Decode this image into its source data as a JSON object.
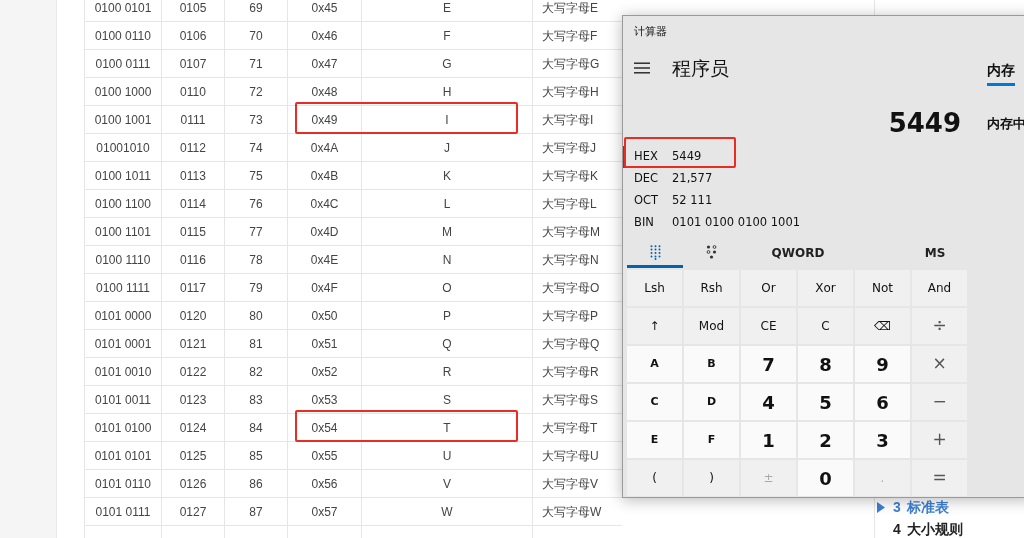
{
  "table": {
    "rows": [
      {
        "binary": "0100 0101",
        "octal": "0105",
        "decimal": "69",
        "hex": "0x45",
        "char": "E",
        "description": "大写字母E",
        "highlighted": false
      },
      {
        "binary": "0100 0110",
        "octal": "0106",
        "decimal": "70",
        "hex": "0x46",
        "char": "F",
        "description": "大写字母F",
        "highlighted": false
      },
      {
        "binary": "0100 0111",
        "octal": "0107",
        "decimal": "71",
        "hex": "0x47",
        "char": "G",
        "description": "大写字母G",
        "highlighted": false
      },
      {
        "binary": "0100 1000",
        "octal": "0110",
        "decimal": "72",
        "hex": "0x48",
        "char": "H",
        "description": "大写字母H",
        "highlighted": false
      },
      {
        "binary": "0100 1001",
        "octal": "0111",
        "decimal": "73",
        "hex": "0x49",
        "char": "I",
        "description": "大写字母I",
        "highlighted": true
      },
      {
        "binary": "01001010",
        "octal": "0112",
        "decimal": "74",
        "hex": "0x4A",
        "char": "J",
        "description": "大写字母J",
        "highlighted": false
      },
      {
        "binary": "0100 1011",
        "octal": "0113",
        "decimal": "75",
        "hex": "0x4B",
        "char": "K",
        "description": "大写字母K",
        "highlighted": false
      },
      {
        "binary": "0100 1100",
        "octal": "0114",
        "decimal": "76",
        "hex": "0x4C",
        "char": "L",
        "description": "大写字母L",
        "highlighted": false
      },
      {
        "binary": "0100 1101",
        "octal": "0115",
        "decimal": "77",
        "hex": "0x4D",
        "char": "M",
        "description": "大写字母M",
        "highlighted": false
      },
      {
        "binary": "0100 1110",
        "octal": "0116",
        "decimal": "78",
        "hex": "0x4E",
        "char": "N",
        "description": "大写字母N",
        "highlighted": false
      },
      {
        "binary": "0100 1111",
        "octal": "0117",
        "decimal": "79",
        "hex": "0x4F",
        "char": "O",
        "description": "大写字母O",
        "highlighted": false
      },
      {
        "binary": "0101 0000",
        "octal": "0120",
        "decimal": "80",
        "hex": "0x50",
        "char": "P",
        "description": "大写字母P",
        "highlighted": false
      },
      {
        "binary": "0101 0001",
        "octal": "0121",
        "decimal": "81",
        "hex": "0x51",
        "char": "Q",
        "description": "大写字母Q",
        "highlighted": false
      },
      {
        "binary": "0101 0010",
        "octal": "0122",
        "decimal": "82",
        "hex": "0x52",
        "char": "R",
        "description": "大写字母R",
        "highlighted": false
      },
      {
        "binary": "0101 0011",
        "octal": "0123",
        "decimal": "83",
        "hex": "0x53",
        "char": "S",
        "description": "大写字母S",
        "highlighted": false
      },
      {
        "binary": "0101 0100",
        "octal": "0124",
        "decimal": "84",
        "hex": "0x54",
        "char": "T",
        "description": "大写字母T",
        "highlighted": true
      },
      {
        "binary": "0101 0101",
        "octal": "0125",
        "decimal": "85",
        "hex": "0x55",
        "char": "U",
        "description": "大写字母U",
        "highlighted": false
      },
      {
        "binary": "0101 0110",
        "octal": "0126",
        "decimal": "86",
        "hex": "0x56",
        "char": "V",
        "description": "大写字母V",
        "highlighted": false
      },
      {
        "binary": "0101 0111",
        "octal": "0127",
        "decimal": "87",
        "hex": "0x57",
        "char": "W",
        "description": "大写字母W",
        "highlighted": false
      }
    ]
  },
  "calculator": {
    "window_title": "计算器",
    "mode_title": "程序员",
    "memory_tab": {
      "label": "内存",
      "selected": true
    },
    "display": "5449",
    "memory_text": "内存中",
    "radix": [
      {
        "label": "HEX",
        "value": "5449",
        "selected": true,
        "highlighted": true
      },
      {
        "label": "DEC",
        "value": "21,577",
        "selected": false,
        "highlighted": false
      },
      {
        "label": "OCT",
        "value": "52 111",
        "selected": false,
        "highlighted": false
      },
      {
        "label": "BIN",
        "value": "0101 0100 0100 1001",
        "selected": false,
        "highlighted": false
      }
    ],
    "keypad_modes": [
      {
        "kind": "full-keypad",
        "selected": true
      },
      {
        "kind": "bit-toggling",
        "selected": false
      }
    ],
    "word_size": "QWORD",
    "memory_store": "MS",
    "keys": [
      {
        "label": "Lsh",
        "kind": "function",
        "disabled": false
      },
      {
        "label": "Rsh",
        "kind": "function",
        "disabled": false
      },
      {
        "label": "Or",
        "kind": "function",
        "disabled": false
      },
      {
        "label": "Xor",
        "kind": "function",
        "disabled": false
      },
      {
        "label": "Not",
        "kind": "function",
        "disabled": false
      },
      {
        "label": "And",
        "kind": "function",
        "disabled": false
      },
      {
        "label": "↑",
        "kind": "function",
        "disabled": false
      },
      {
        "label": "Mod",
        "kind": "function",
        "disabled": false
      },
      {
        "label": "CE",
        "kind": "function",
        "disabled": false
      },
      {
        "label": "C",
        "kind": "function",
        "disabled": false
      },
      {
        "label": "⌫",
        "kind": "function",
        "disabled": false
      },
      {
        "label": "÷",
        "kind": "operator",
        "disabled": false
      },
      {
        "label": "A",
        "kind": "hex",
        "disabled": false
      },
      {
        "label": "B",
        "kind": "hex",
        "disabled": false
      },
      {
        "label": "7",
        "kind": "digit",
        "disabled": false
      },
      {
        "label": "8",
        "kind": "digit",
        "disabled": false
      },
      {
        "label": "9",
        "kind": "digit",
        "disabled": false
      },
      {
        "label": "×",
        "kind": "operator",
        "disabled": false
      },
      {
        "label": "C",
        "kind": "hex",
        "disabled": false
      },
      {
        "label": "D",
        "kind": "hex",
        "disabled": false
      },
      {
        "label": "4",
        "kind": "digit",
        "disabled": false
      },
      {
        "label": "5",
        "kind": "digit",
        "disabled": false
      },
      {
        "label": "6",
        "kind": "digit",
        "disabled": false
      },
      {
        "label": "−",
        "kind": "operator",
        "disabled": false
      },
      {
        "label": "E",
        "kind": "hex",
        "disabled": false
      },
      {
        "label": "F",
        "kind": "hex",
        "disabled": false
      },
      {
        "label": "1",
        "kind": "digit",
        "disabled": false
      },
      {
        "label": "2",
        "kind": "digit",
        "disabled": false
      },
      {
        "label": "3",
        "kind": "digit",
        "disabled": false
      },
      {
        "label": "+",
        "kind": "operator",
        "disabled": false
      },
      {
        "label": "(",
        "kind": "function",
        "disabled": false
      },
      {
        "label": ")",
        "kind": "function",
        "disabled": false
      },
      {
        "label": "±",
        "kind": "function",
        "disabled": true
      },
      {
        "label": "0",
        "kind": "digit",
        "disabled": false
      },
      {
        "label": ".",
        "kind": "digit",
        "disabled": true
      },
      {
        "label": "=",
        "kind": "operator",
        "disabled": false
      }
    ]
  },
  "toc": [
    {
      "number": "3",
      "title": "标准表",
      "selected": true
    },
    {
      "number": "4",
      "title": "大小规则",
      "selected": false
    }
  ]
}
